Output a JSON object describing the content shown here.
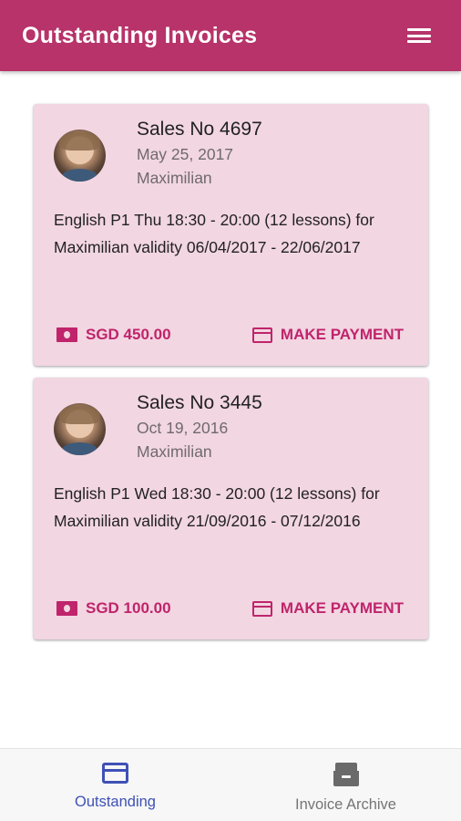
{
  "app_bar": {
    "title": "Outstanding Invoices",
    "background_color": "#b7336a",
    "menu_icon": "hamburger-menu-icon"
  },
  "invoices": [
    {
      "sales_no": "Sales No 4697",
      "date": "May 25, 2017",
      "student": "Maximilian",
      "description": "English P1 Thu 18:30 - 20:00 (12 lessons) for Maximilian validity 06/04/2017 - 22/06/2017",
      "amount": "SGD 450.00",
      "amount_icon": "money-icon",
      "pay_label": "MAKE PAYMENT",
      "pay_icon": "credit-card-icon"
    },
    {
      "sales_no": "Sales No 3445",
      "date": "Oct 19, 2016",
      "student": "Maximilian",
      "description": "English P1 Wed 18:30 - 20:00 (12 lessons) for Maximilian validity 21/09/2016 - 07/12/2016",
      "amount": "SGD 100.00",
      "amount_icon": "money-icon",
      "pay_label": "MAKE PAYMENT",
      "pay_icon": "credit-card-icon"
    }
  ],
  "colors": {
    "card_background": "#f2d6e2",
    "accent": "#c0246b",
    "nav_active": "#3f51b5",
    "nav_inactive": "#757575"
  },
  "bottom_nav": {
    "items": [
      {
        "label": "Outstanding",
        "icon": "credit-card-icon",
        "active": true
      },
      {
        "label": "Invoice Archive",
        "icon": "archive-icon",
        "active": false
      }
    ]
  }
}
